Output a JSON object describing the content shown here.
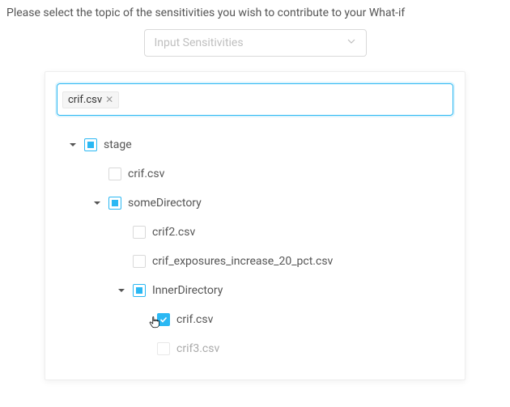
{
  "instruction": "Please select the topic of the sensitivities you wish to contribute to your What-if",
  "select": {
    "placeholder": "Input Sensitivities"
  },
  "search": {
    "tag_label": "crif.csv"
  },
  "tree": {
    "node0": {
      "label": "stage"
    },
    "node1": {
      "label": "crif.csv"
    },
    "node2": {
      "label": "someDirectory"
    },
    "node3": {
      "label": "crif2.csv"
    },
    "node4": {
      "label": "crif_exposures_increase_20_pct.csv"
    },
    "node5": {
      "label": "InnerDirectory"
    },
    "node6": {
      "label": "crif.csv"
    },
    "node7": {
      "label": "crif3.csv"
    }
  }
}
